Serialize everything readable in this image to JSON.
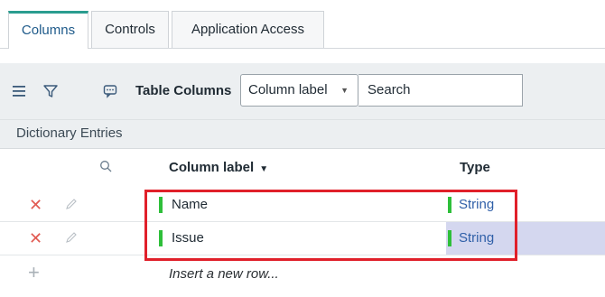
{
  "tabs": [
    {
      "label": "Columns",
      "active": true
    },
    {
      "label": "Controls",
      "active": false
    },
    {
      "label": "Application Access",
      "active": false
    }
  ],
  "toolbar": {
    "menu_icon": "hamburger-menu-icon",
    "filter_icon": "filter-icon",
    "chat_icon": "chat-bubble-icon",
    "title": "Table Columns",
    "field_select": "Column label",
    "search_placeholder": "Search"
  },
  "breadcrumb": {
    "label": "Dictionary Entries"
  },
  "grid": {
    "columns": [
      {
        "label": "Column label",
        "sorted": "desc"
      },
      {
        "label": "Type"
      }
    ],
    "rows": [
      {
        "name": "Name",
        "type": "String"
      },
      {
        "name": "Issue",
        "type": "String"
      }
    ],
    "insert_text": "Insert a new row..."
  },
  "colors": {
    "accent": "#2a9d8f",
    "delete": "#e15a52",
    "link": "#2f5fa8",
    "status_green": "#2ebf3a",
    "selection": "#d4d7ef",
    "highlight": "#e0202a"
  }
}
